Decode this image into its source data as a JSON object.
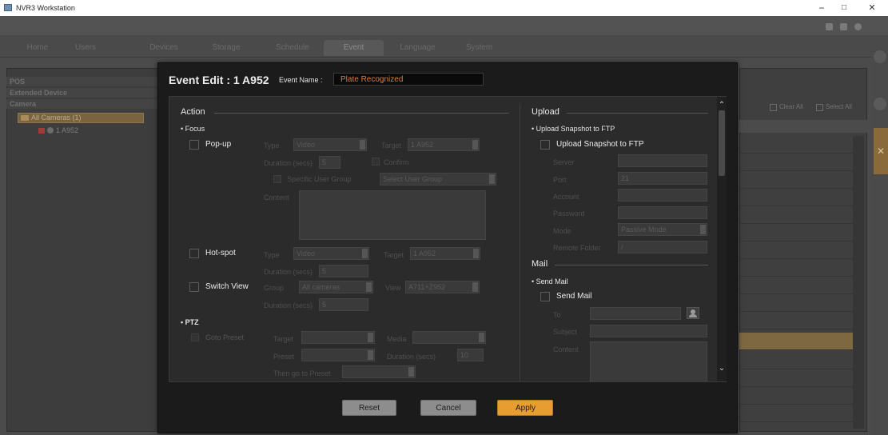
{
  "window": {
    "title": "NVR3 Workstation",
    "minimize": "−",
    "maximize": "□",
    "close": "✕"
  },
  "nav": {
    "tabs": [
      "Home",
      "Users",
      "Devices",
      "Storage",
      "Schedule",
      "Event",
      "Language",
      "System"
    ],
    "active": "Event"
  },
  "left_panel": {
    "headers": [
      "POS",
      "Extended Device",
      "Camera"
    ],
    "tree": {
      "all_cameras": "All Cameras (1)",
      "camera": "1 A952"
    }
  },
  "right_panel": {
    "clear_all": "Clear All",
    "select_all": "Select All"
  },
  "modal": {
    "title": "Event Edit : 1 A952",
    "event_name_label": "Event Name :",
    "event_name_value": "Plate Recognized",
    "action": {
      "title": "Action",
      "focus_bullet": "• Focus",
      "popup": {
        "label": "Pop-up",
        "type_label": "Type",
        "type_value": "Video",
        "target_label": "Target",
        "target_value": "1 A952",
        "duration_label": "Duration (secs)",
        "duration_value": "5",
        "confirm_label": "Confirm",
        "user_group_label": "Specific User Group",
        "user_group_value": "Select User Group",
        "content_label": "Content"
      },
      "hotspot": {
        "label": "Hot-spot",
        "type_label": "Type",
        "type_value": "Video",
        "target_label": "Target",
        "target_value": "1 A952",
        "duration_label": "Duration (secs)",
        "duration_value": "5"
      },
      "switch_view": {
        "label": "Switch View",
        "group_label": "Group",
        "group_value": "All cameras",
        "view_label": "View",
        "view_value": "A711+Z952",
        "duration_label": "Duration (secs)",
        "duration_value": "5"
      },
      "ptz_bullet": "• PTZ",
      "goto_preset": {
        "label": "Goto Preset",
        "target_label": "Target",
        "target_value": "",
        "media_label": "Media",
        "media_value": "",
        "preset_label": "Preset",
        "preset_value": "",
        "duration_label": "Duration (secs)",
        "duration_value": "10",
        "then_label": "Then go to Preset",
        "then_value": ""
      }
    },
    "upload": {
      "title": "Upload",
      "ftp_bullet": "• Upload Snapshot to FTP",
      "ftp_checkbox": "Upload Snapshot to FTP",
      "server_label": "Server",
      "server_value": "",
      "port_label": "Port",
      "port_value": "21",
      "account_label": "Account",
      "account_value": "",
      "password_label": "Password",
      "password_value": "",
      "mode_label": "Mode",
      "mode_value": "Passive Mode",
      "remote_folder_label": "Remote Folder",
      "remote_folder_value": "/"
    },
    "mail": {
      "title": "Mail",
      "send_bullet": "• Send Mail",
      "send_checkbox": "Send Mail",
      "to_label": "To",
      "to_value": "",
      "subject_label": "Subject",
      "subject_value": "",
      "content_label": "Content"
    },
    "buttons": {
      "reset": "Reset",
      "cancel": "Cancel",
      "apply": "Apply"
    }
  },
  "colors": {
    "accent": "#e89d32",
    "event_name_text": "#e07d3c",
    "selected_row": "#7d6842"
  }
}
